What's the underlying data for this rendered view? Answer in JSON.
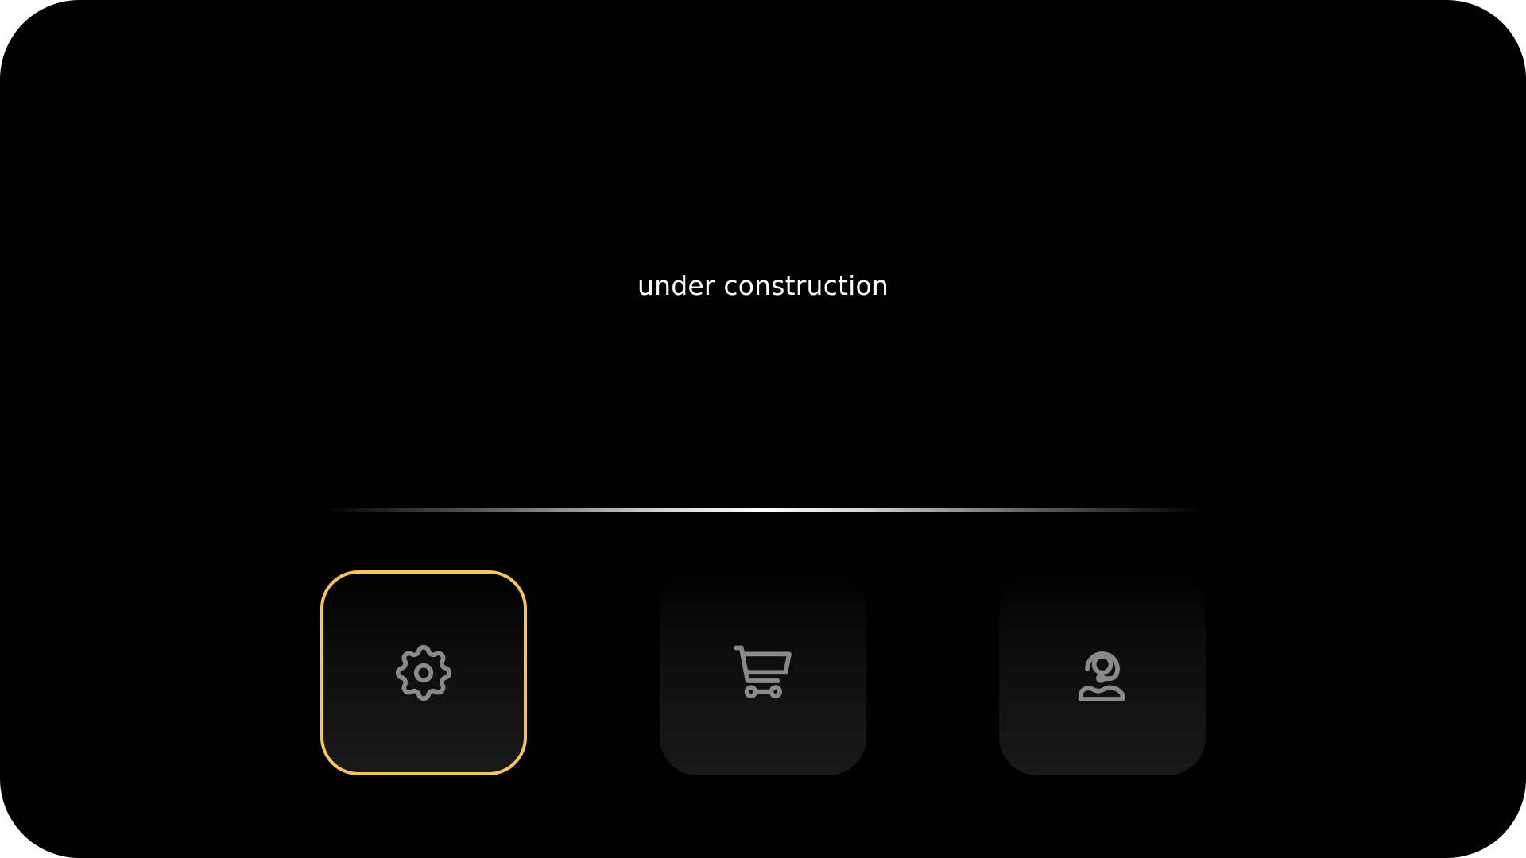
{
  "status": {
    "message": "under construction"
  },
  "tiles": [
    {
      "id": "settings",
      "icon": "gear-icon",
      "selected": true
    },
    {
      "id": "cart",
      "icon": "shopping-cart-icon",
      "selected": false
    },
    {
      "id": "support",
      "icon": "support-agent-icon",
      "selected": false
    }
  ],
  "colors": {
    "background": "#000000",
    "text": "#ffffff",
    "selection_outline": "#f7c35c",
    "icon_stroke": "#8a8a8a"
  }
}
